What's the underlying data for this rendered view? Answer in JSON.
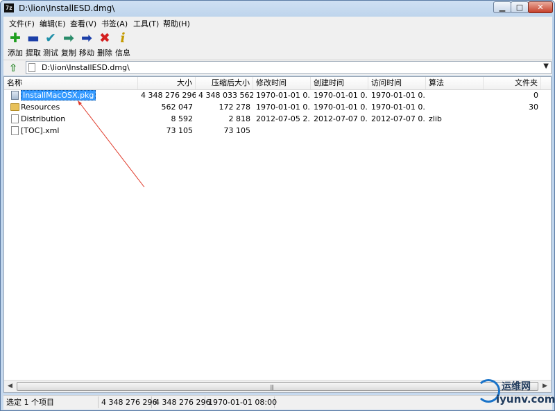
{
  "window": {
    "title": "D:\\lion\\InstallESD.dmg\\",
    "app_icon_text": "7z",
    "buttons": {
      "minimize": "▁",
      "maximize": "□",
      "close": "✕"
    }
  },
  "menu": [
    "文件(F)",
    "编辑(E)",
    "查看(V)",
    "书签(A)",
    "工具(T)",
    "帮助(H)"
  ],
  "toolbar": [
    {
      "label": "添加",
      "icon": "add-icon",
      "glyph": "✚",
      "color": "#1f9e1f"
    },
    {
      "label": "提取",
      "icon": "extract-icon",
      "glyph": "▬",
      "color": "#1c3fa8"
    },
    {
      "label": "测试",
      "icon": "test-icon",
      "glyph": "✔",
      "color": "#1e8fa8"
    },
    {
      "label": "复制",
      "icon": "copy-icon",
      "glyph": "➡",
      "color": "#2a8c6a"
    },
    {
      "label": "移动",
      "icon": "move-icon",
      "glyph": "➡",
      "color": "#1c3fa8"
    },
    {
      "label": "删除",
      "icon": "delete-icon",
      "glyph": "✖",
      "color": "#d42020"
    },
    {
      "label": "信息",
      "icon": "info-icon",
      "glyph": "i",
      "color": "#c49a00"
    }
  ],
  "address": {
    "path": "D:\\lion\\InstallESD.dmg\\"
  },
  "columns": [
    "名称",
    "大小",
    "压缩后大小",
    "修改时间",
    "创建时间",
    "访问时间",
    "算法",
    "文件夹"
  ],
  "rows": [
    {
      "type": "pkg",
      "name": "InstallMacOSX.pkg",
      "size": "4 348 276 296",
      "packed": "4 348 033 562",
      "modified": "1970-01-01 0...",
      "created": "1970-01-01 0...",
      "accessed": "1970-01-01 0...",
      "method": "",
      "folders": "0",
      "selected": true
    },
    {
      "type": "folder",
      "name": "Resources",
      "size": "562 047",
      "packed": "172 278",
      "modified": "1970-01-01 0...",
      "created": "1970-01-01 0...",
      "accessed": "1970-01-01 0...",
      "method": "",
      "folders": "30",
      "selected": false
    },
    {
      "type": "file",
      "name": "Distribution",
      "size": "8 592",
      "packed": "2 818",
      "modified": "2012-07-05 2...",
      "created": "2012-07-07 0...",
      "accessed": "2012-07-07 0...",
      "method": "zlib",
      "folders": "",
      "selected": false
    },
    {
      "type": "file",
      "name": "[TOC].xml",
      "size": "73 105",
      "packed": "73 105",
      "modified": "",
      "created": "",
      "accessed": "",
      "method": "",
      "folders": "",
      "selected": false
    }
  ],
  "status": {
    "selection": "选定 1 个项目",
    "size": "4 348 276 296",
    "packed": "4 348 276 296",
    "date": "1970-01-01 08:00"
  },
  "watermark": {
    "title": "运维网",
    "domain": "iyunv.com"
  }
}
